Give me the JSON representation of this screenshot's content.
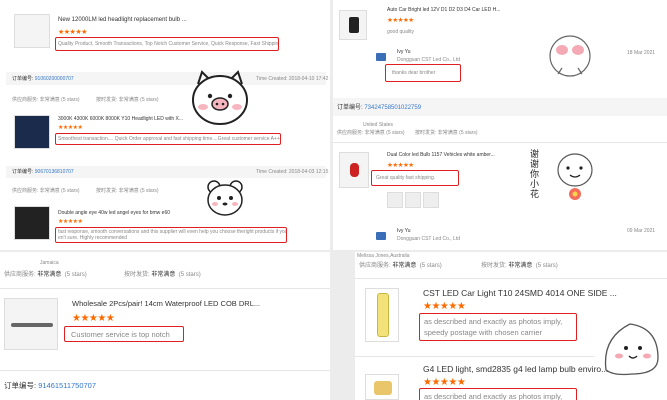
{
  "left": {
    "r1": {
      "title": "New 12000LM led headlight replacement bulb ...",
      "stars": "★★★★★",
      "comment": "Quality Product, Smooth Transactions, Top Notch Customer Service, Quick Response, Fast Shipping Than..."
    },
    "o2": {
      "order_label": "订单编号:",
      "order_no": "91060200000707",
      "time": "Time Created: 2018-04-10 17:42"
    },
    "r2": {
      "service_label": "供应商服务: 非常满意  (5 stars)",
      "shipping_label": "按时发货: 非常满意  (5 stars)",
      "title": "3000K 4300K 6000K 8000K Y10 Headlight LED with X...",
      "stars": "★★★★★",
      "comment": "Smoothest transaction.... Quick Order approval and fast shipping time....Great customer service A+++"
    },
    "o3": {
      "order_label": "订单编号:",
      "order_no": "90670136810707",
      "time": "Time Created: 2018-04-03 12:15"
    },
    "r3": {
      "service_label": "供应商服务: 非常满意  (5 stars)",
      "shipping_label": "按时发货: 非常满意  (5 stars)",
      "title": "Double angle eye 40w led angel eyes for bmw e60",
      "stars": "★★★★★",
      "comment_line1": "fast response, smooth conversations and this supplier will even help you choose theright products if you ar",
      "comment_line2": "en't sure. Highly recommended"
    },
    "r4": {
      "location": "Jamaica",
      "service_label": "供应商服务:",
      "service_value": "非常满意",
      "service_stars": "(5 stars)",
      "shipping_label": "按时发货:",
      "shipping_value": "非常满意",
      "shipping_stars": "(5 stars)",
      "title": "Wholesale 2Pcs/pair! 14cm Waterproof LED COB DRL...",
      "stars": "★★★★★",
      "comment": "Customer service is top notch"
    },
    "footer": {
      "order_label": "订单编号:",
      "order_no": "91461511750707"
    }
  },
  "right_top": {
    "r1": {
      "title": "Auto Car Bright led 12V D1 D2 D3 D4 Car LED H...",
      "stars": "★★★★★",
      "rating_text": "good quality",
      "seller_name": "Ivy Yu",
      "seller_company": "Dongguan CST Led Co., Ltd",
      "date": "18 Mar 2021",
      "reply": "thanks dear brother"
    },
    "o2": {
      "order_label": "订单编号:",
      "order_no": "73424758501022759"
    },
    "r2": {
      "location": "United States",
      "service_label": "供应商服务: 非常满意  (5 stars)",
      "shipping_label": "按时发货: 非常满意  (5 stars)",
      "title": "Dual Color led Bulb 1157 Vehicles white amber...",
      "stars": "★★★★★",
      "comment": "Great quality fast shipping.",
      "seller_name": "Ivy Yu",
      "seller_company": "Dongguan CST Led Co., Ltd",
      "date": "09 Mar 2021"
    }
  },
  "right_bottom": {
    "location": "Melissa Jones,Australia",
    "service_label": "供应商服务:",
    "service_value": "非常满意",
    "service_stars": "(5 stars)",
    "shipping_label": "按时发货:",
    "shipping_value": "非常满意",
    "shipping_stars": "(5 stars)",
    "r1": {
      "title": "CST LED Car Light T10 24SMD 4014 ONE SIDE ...",
      "stars": "★★★★★",
      "comment_line1": "as described and exactly as photos imply,",
      "comment_line2": "speedy postage with chosen carrier"
    },
    "r2": {
      "title": "G4 LED light, smd2835 g4 led lamp bulb enviro...",
      "stars": "★★★★★",
      "comment_line1": "as described and exactly as photos imply,"
    }
  },
  "stickers": {
    "sticker2_text": "谢谢你小花"
  },
  "colors": {
    "accent_star": "#ff6a00",
    "highlight_box": "#e02020",
    "link": "#3377cc"
  }
}
